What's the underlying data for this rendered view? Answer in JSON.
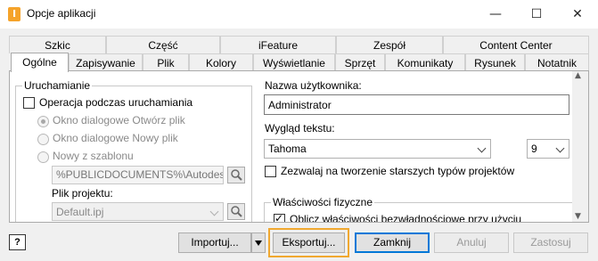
{
  "window": {
    "title": "Opcje aplikacji",
    "icon_name": "inventor-app-icon",
    "minimize_glyph": "—",
    "maximize_glyph": "☐",
    "close_glyph": "✕"
  },
  "tabs_row1": [
    "Szkic",
    "Część",
    "iFeature",
    "Zespół",
    "Content Center"
  ],
  "tabs_row2": [
    "Ogólne",
    "Zapisywanie",
    "Plik",
    "Kolory",
    "Wyświetlanie",
    "Sprzęt",
    "Komunikaty",
    "Rysunek",
    "Notatnik"
  ],
  "active_tab": "Ogólne",
  "startup": {
    "group_label": "Uruchamianie",
    "operation_checkbox_label": "Operacja podczas uruchamiania",
    "operation_checked": false,
    "radio_open_dialog": "Okno dialogowe Otwórz plik",
    "radio_new_dialog": "Okno dialogowe Nowy plik",
    "radio_from_template": "Nowy z szablonu",
    "template_path": "%PUBLICDOCUMENTS%\\Autodes",
    "project_file_label": "Plik projektu:",
    "project_file_value": "Default.ipj"
  },
  "user": {
    "name_label": "Nazwa użytkownika:",
    "name_value": "Administrator"
  },
  "text_appearance": {
    "label": "Wygląd tekstu:",
    "font_value": "Tahoma",
    "size_value": "9",
    "legacy_checkbox_label": "Zezwalaj na tworzenie starszych typów projektów",
    "legacy_checked": false
  },
  "physical": {
    "group_label": "Właściwości fizyczne",
    "compute_checkbox_label": "Oblicz właściwości bezwładnościowe przy użyciu",
    "compute_checked": true
  },
  "footer": {
    "help_glyph": "?",
    "import_label": "Importuj...",
    "export_label": "Eksportuj...",
    "close_label": "Zamknij",
    "cancel_label": "Anuluj",
    "apply_label": "Zastosuj",
    "highlight_color": "#f0a830"
  }
}
